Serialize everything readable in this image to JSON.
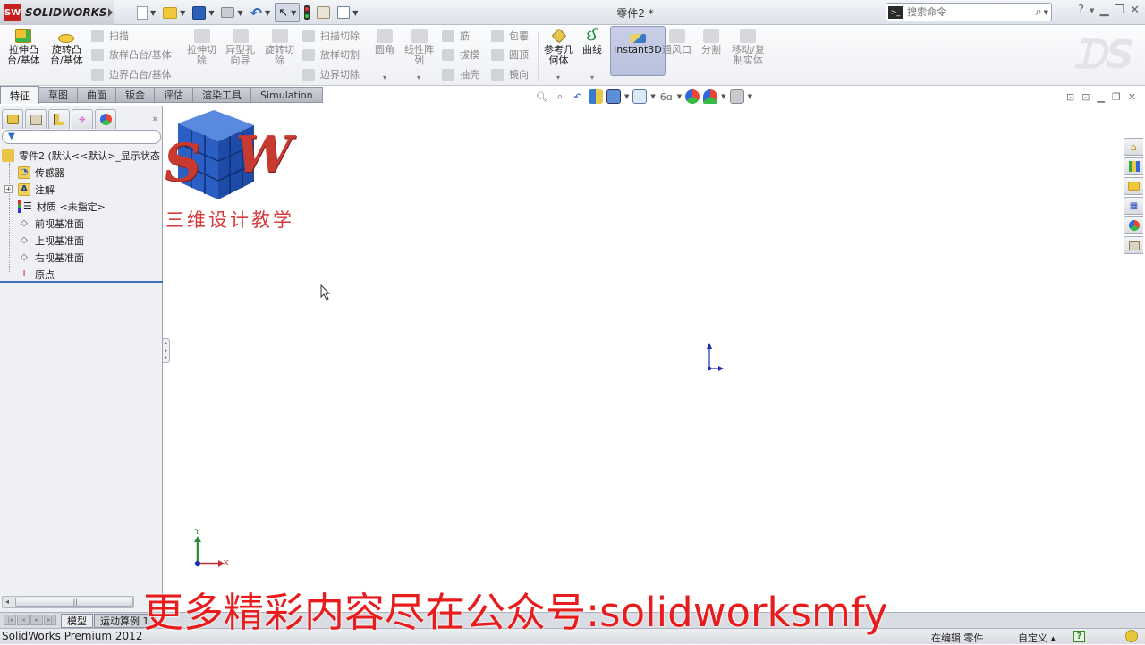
{
  "app": {
    "brand": "SOLIDWORKS",
    "document_title": "零件2 *",
    "quick_access": [
      {
        "name": "new",
        "icon": "new-document-icon"
      },
      {
        "name": "open",
        "icon": "open-folder-icon"
      },
      {
        "name": "save",
        "icon": "save-icon"
      },
      {
        "name": "print",
        "icon": "print-icon"
      },
      {
        "name": "undo",
        "icon": "undo-icon"
      },
      {
        "name": "select",
        "icon": "select-cursor-icon"
      },
      {
        "name": "rebuild",
        "icon": "rebuild-traffic-light-icon"
      },
      {
        "name": "file-properties",
        "icon": "file-properties-icon"
      },
      {
        "name": "options",
        "icon": "options-icon"
      }
    ],
    "search_placeholder": "搜索命令"
  },
  "ribbon": {
    "features": {
      "extrude_boss": "拉伸凸\n台/基体",
      "revolve_boss": "旋转凸\n台/基体",
      "sweep": "扫描",
      "loft": "放样凸台/基体",
      "boundary": "边界凸台/基体",
      "extrude_cut": "拉伸切\n除",
      "hole_wizard": "异型孔\n向导",
      "revolve_cut": "旋转切\n除",
      "swept_cut": "扫描切除",
      "lofted_cut": "放样切割",
      "boundary_cut": "边界切除",
      "fillet": "圆角",
      "linear_pattern": "线性阵\n列",
      "rib": "筋",
      "draft": "拔模",
      "shell": "抽壳",
      "wrap": "包覆",
      "dome": "圆顶",
      "mirror": "镜向",
      "reference_geometry": "参考几\n何体",
      "curves": "曲线",
      "instant3d": "Instant3D",
      "vent": "通风口",
      "split": "分割",
      "move_copy_body": "移动/复\n制实体"
    }
  },
  "tabs": [
    "特征",
    "草图",
    "曲面",
    "钣金",
    "评估",
    "渲染工具",
    "Simulation"
  ],
  "active_tab": "特征",
  "feature_tree": {
    "root": "零件2  (默认<<默认>_显示状态",
    "items": [
      {
        "label": "传感器",
        "icon": "sensor-folder-icon"
      },
      {
        "label": "注解",
        "icon": "annotations-folder-icon",
        "expandable": true
      },
      {
        "label": "材质 <未指定>",
        "icon": "material-icon"
      },
      {
        "label": "前视基准面",
        "icon": "plane-icon"
      },
      {
        "label": "上视基准面",
        "icon": "plane-icon"
      },
      {
        "label": "右视基准面",
        "icon": "plane-icon"
      },
      {
        "label": "原点",
        "icon": "origin-icon"
      }
    ]
  },
  "watermark": {
    "letters": [
      "S",
      "W"
    ],
    "caption": "三维设计教学"
  },
  "triad": {
    "x_label": "X",
    "y_label": "Y"
  },
  "bottom_tabs": [
    "模型",
    "运动算例 1"
  ],
  "status": {
    "product": "SolidWorks Premium 2012",
    "editing": "在编辑 零件",
    "customize": "自定义 ▴",
    "help": "?"
  },
  "overlay_text": "更多精彩内容尽在公众号:solidworksmfy"
}
